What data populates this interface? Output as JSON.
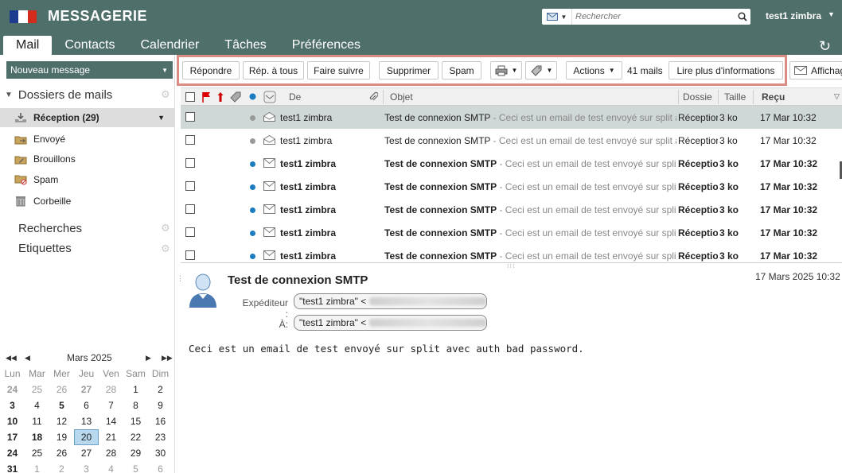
{
  "app": {
    "title": "MESSAGERIE",
    "flag_colors": [
      "#1d3b8f",
      "#ffffff",
      "#d52b1e"
    ]
  },
  "search": {
    "placeholder": "Rechercher"
  },
  "user": {
    "name": "test1 zimbra"
  },
  "tabs": [
    {
      "label": "Mail",
      "active": true
    },
    {
      "label": "Contacts"
    },
    {
      "label": "Calendrier"
    },
    {
      "label": "Tâches"
    },
    {
      "label": "Préférences"
    }
  ],
  "sidebar": {
    "new_message": "Nouveau message",
    "folders_header": "Dossiers de mails",
    "folders": [
      {
        "label": "Réception (29)",
        "icon": "inbox-icon",
        "selected": true
      },
      {
        "label": "Envoyé",
        "icon": "sent-icon"
      },
      {
        "label": "Brouillons",
        "icon": "drafts-icon"
      },
      {
        "label": "Spam",
        "icon": "spam-icon"
      },
      {
        "label": "Corbeille",
        "icon": "trash-icon"
      }
    ],
    "searches_header": "Recherches",
    "tags_header": "Etiquettes"
  },
  "calendar": {
    "month": "Mars 2025",
    "day_names": [
      "Lun",
      "Mar",
      "Mer",
      "Jeu",
      "Ven",
      "Sam",
      "Dim"
    ],
    "weeks": [
      [
        "24",
        "25",
        "26",
        "27",
        "28",
        "1",
        "2"
      ],
      [
        "3",
        "4",
        "5",
        "6",
        "7",
        "8",
        "9"
      ],
      [
        "10",
        "11",
        "12",
        "13",
        "14",
        "15",
        "16"
      ],
      [
        "17",
        "18",
        "19",
        "20",
        "21",
        "22",
        "23"
      ],
      [
        "24",
        "25",
        "26",
        "27",
        "28",
        "29",
        "30"
      ],
      [
        "31",
        "1",
        "2",
        "3",
        "4",
        "5",
        "6"
      ]
    ],
    "today": "20"
  },
  "toolbar": {
    "reply": "Répondre",
    "reply_all": "Rép. à tous",
    "forward": "Faire suivre",
    "delete": "Supprimer",
    "spam": "Spam",
    "actions": "Actions",
    "mail_count": "41 mails",
    "read_more": "Lire plus d'informations",
    "display": "Affichag"
  },
  "list": {
    "columns": {
      "from": "De",
      "subject": "Objet",
      "folder": "Dossie",
      "size": "Taille",
      "received": "Reçu"
    },
    "rows": [
      {
        "from": "test1 zimbra",
        "subject": "Test de connexion SMTP",
        "fragment": " - Ceci est un email de test envoyé sur split avec auth bad password.",
        "folder": "Réception",
        "size": "3 ko",
        "date": "17 Mar 10:32",
        "unread": false,
        "selected": true
      },
      {
        "from": "test1 zimbra",
        "subject": "Test de connexion SMTP",
        "fragment": " - Ceci est un email de test envoyé sur split avec auth bad password.",
        "folder": "Réception",
        "size": "3 ko",
        "date": "17 Mar 10:32",
        "unread": false,
        "selected": false
      },
      {
        "from": "test1 zimbra",
        "subject": "Test de connexion SMTP",
        "fragment": " - Ceci est un email de test envoyé sur split avec auth bad password.",
        "folder": "Réception",
        "size": "3 ko",
        "date": "17 Mar 10:32",
        "unread": true,
        "selected": false
      },
      {
        "from": "test1 zimbra",
        "subject": "Test de connexion SMTP",
        "fragment": " - Ceci est un email de test envoyé sur split avec auth bad password.",
        "folder": "Réception",
        "size": "3 ko",
        "date": "17 Mar 10:32",
        "unread": true,
        "selected": false
      },
      {
        "from": "test1 zimbra",
        "subject": "Test de connexion SMTP",
        "fragment": " - Ceci est un email de test envoyé sur split avec auth bad password.",
        "folder": "Réception",
        "size": "3 ko",
        "date": "17 Mar 10:32",
        "unread": true,
        "selected": false
      },
      {
        "from": "test1 zimbra",
        "subject": "Test de connexion SMTP",
        "fragment": " - Ceci est un email de test envoyé sur split avec auth bad password.",
        "folder": "Réception",
        "size": "3 ko",
        "date": "17 Mar 10:32",
        "unread": true,
        "selected": false
      },
      {
        "from": "test1 zimbra",
        "subject": "Test de connexion SMTP",
        "fragment": " - Ceci est un email de test envoyé sur split avec auth bad password.",
        "folder": "Réception",
        "size": "3 ko",
        "date": "17 Mar 10:32",
        "unread": true,
        "selected": false
      }
    ]
  },
  "message": {
    "subject": "Test de connexion SMTP",
    "date": "17 Mars 2025 10:32",
    "from_label": "Expéditeur :",
    "from_value": "\"test1 zimbra\" <",
    "to_label": "À:",
    "to_value": "\"test1 zimbra\" <",
    "body": "Ceci est un email de test envoyé sur split avec auth bad password."
  },
  "colors": {
    "header": "#4f6f6a",
    "unread_dot": "#1a7bbf",
    "read_dot": "#999999",
    "selected_row": "#cfd8d7",
    "toolbar_highlight": "#d98c82"
  }
}
